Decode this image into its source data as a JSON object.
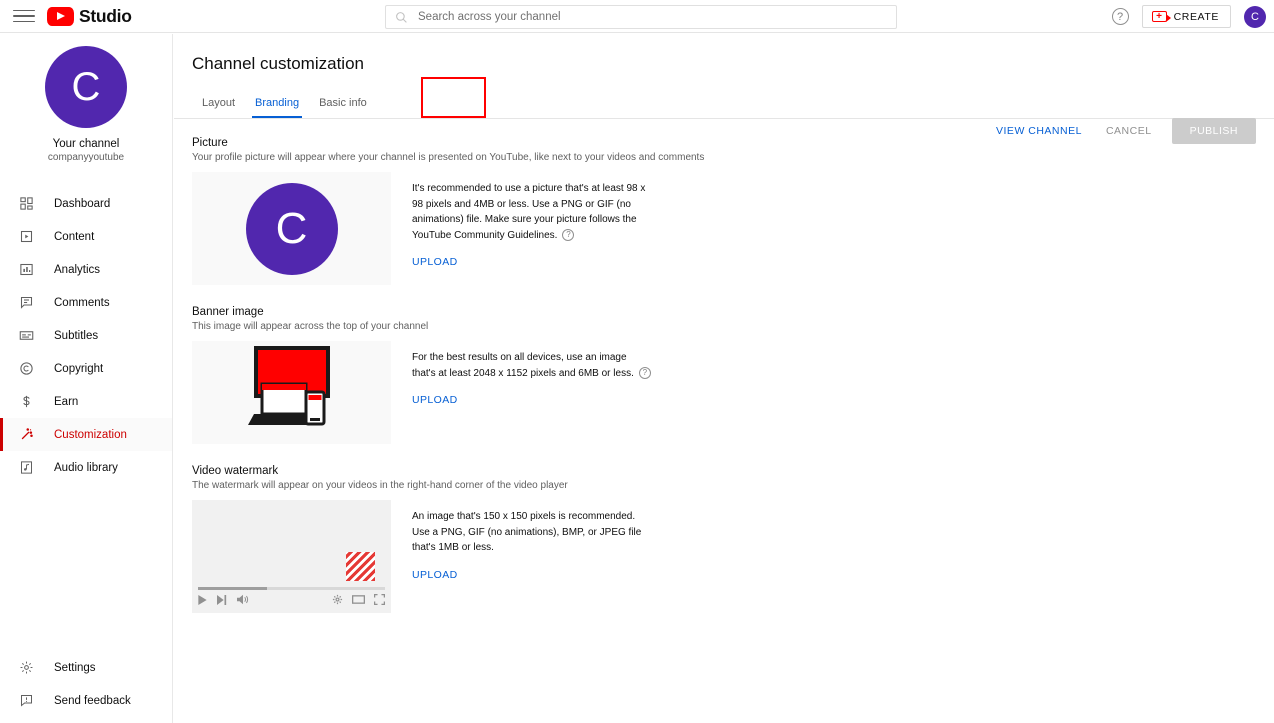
{
  "topbar": {
    "menu_icon": "hamburger-icon",
    "logo_icon": "youtube-logo-icon",
    "brand": "Studio",
    "search": {
      "placeholder": "Search across your channel",
      "value": "",
      "icon": "search-icon"
    },
    "help_icon": "help-icon",
    "create_label": "CREATE",
    "create_icon": "video-camera-plus-icon",
    "create_plus": "+",
    "avatar_letter": "C"
  },
  "sidebar": {
    "avatar_letter": "C",
    "channel_name": "Your channel",
    "channel_handle": "companyyoutube",
    "items": [
      {
        "label": "Dashboard",
        "icon": "dashboard-icon",
        "active": false
      },
      {
        "label": "Content",
        "icon": "content-icon",
        "active": false
      },
      {
        "label": "Analytics",
        "icon": "analytics-icon",
        "active": false
      },
      {
        "label": "Comments",
        "icon": "comments-icon",
        "active": false
      },
      {
        "label": "Subtitles",
        "icon": "subtitles-icon",
        "active": false
      },
      {
        "label": "Copyright",
        "icon": "copyright-icon",
        "active": false
      },
      {
        "label": "Earn",
        "icon": "dollar-icon",
        "active": false
      },
      {
        "label": "Customization",
        "icon": "magic-wand-icon",
        "active": true
      },
      {
        "label": "Audio library",
        "icon": "music-note-icon",
        "active": false
      }
    ],
    "bottom_items": [
      {
        "label": "Settings",
        "icon": "gear-icon"
      },
      {
        "label": "Send feedback",
        "icon": "feedback-icon"
      }
    ]
  },
  "main": {
    "title": "Channel customization",
    "tabs": [
      {
        "label": "Layout",
        "active": false
      },
      {
        "label": "Branding",
        "active": true
      },
      {
        "label": "Basic info",
        "active": false
      }
    ],
    "actions": {
      "view_channel": "VIEW CHANNEL",
      "cancel": "CANCEL",
      "publish": "PUBLISH"
    },
    "sections": [
      {
        "title": "Picture",
        "subtitle": "Your profile picture will appear where your channel is presented on YouTube, like next to your videos and comments",
        "info": "It's recommended to use a picture that's at least 98 x 98 pixels and 4MB or less. Use a PNG or GIF (no animations) file. Make sure your picture follows the YouTube Community Guidelines.",
        "has_help": true,
        "upload": "UPLOAD",
        "preview_letter": "C"
      },
      {
        "title": "Banner image",
        "subtitle": "This image will appear across the top of your channel",
        "info": "For the best results on all devices, use an image that's at least 2048 x 1152 pixels and 6MB or less.",
        "has_help": true,
        "upload": "UPLOAD"
      },
      {
        "title": "Video watermark",
        "subtitle": "The watermark will appear on your videos in the right-hand corner of the video player",
        "info": "An image that's 150 x 150 pixels is recommended. Use a PNG, GIF (no animations), BMP, or JPEG file that's 1MB or less.",
        "has_help": false,
        "upload": "UPLOAD"
      }
    ],
    "watermark_player": {
      "progress_percent": 37,
      "controls_left": [
        "play-icon",
        "next-track-icon",
        "volume-icon"
      ],
      "controls_right": [
        "settings-gear-icon",
        "theater-mode-icon",
        "fullscreen-icon"
      ]
    }
  },
  "colors": {
    "brand_red": "#ff0000",
    "active_red": "#cc0000",
    "link_blue": "#065fd4",
    "avatar_purple": "#5127ae",
    "publish_disabled": "#cccccc",
    "annotation_red": "#ff0000"
  }
}
